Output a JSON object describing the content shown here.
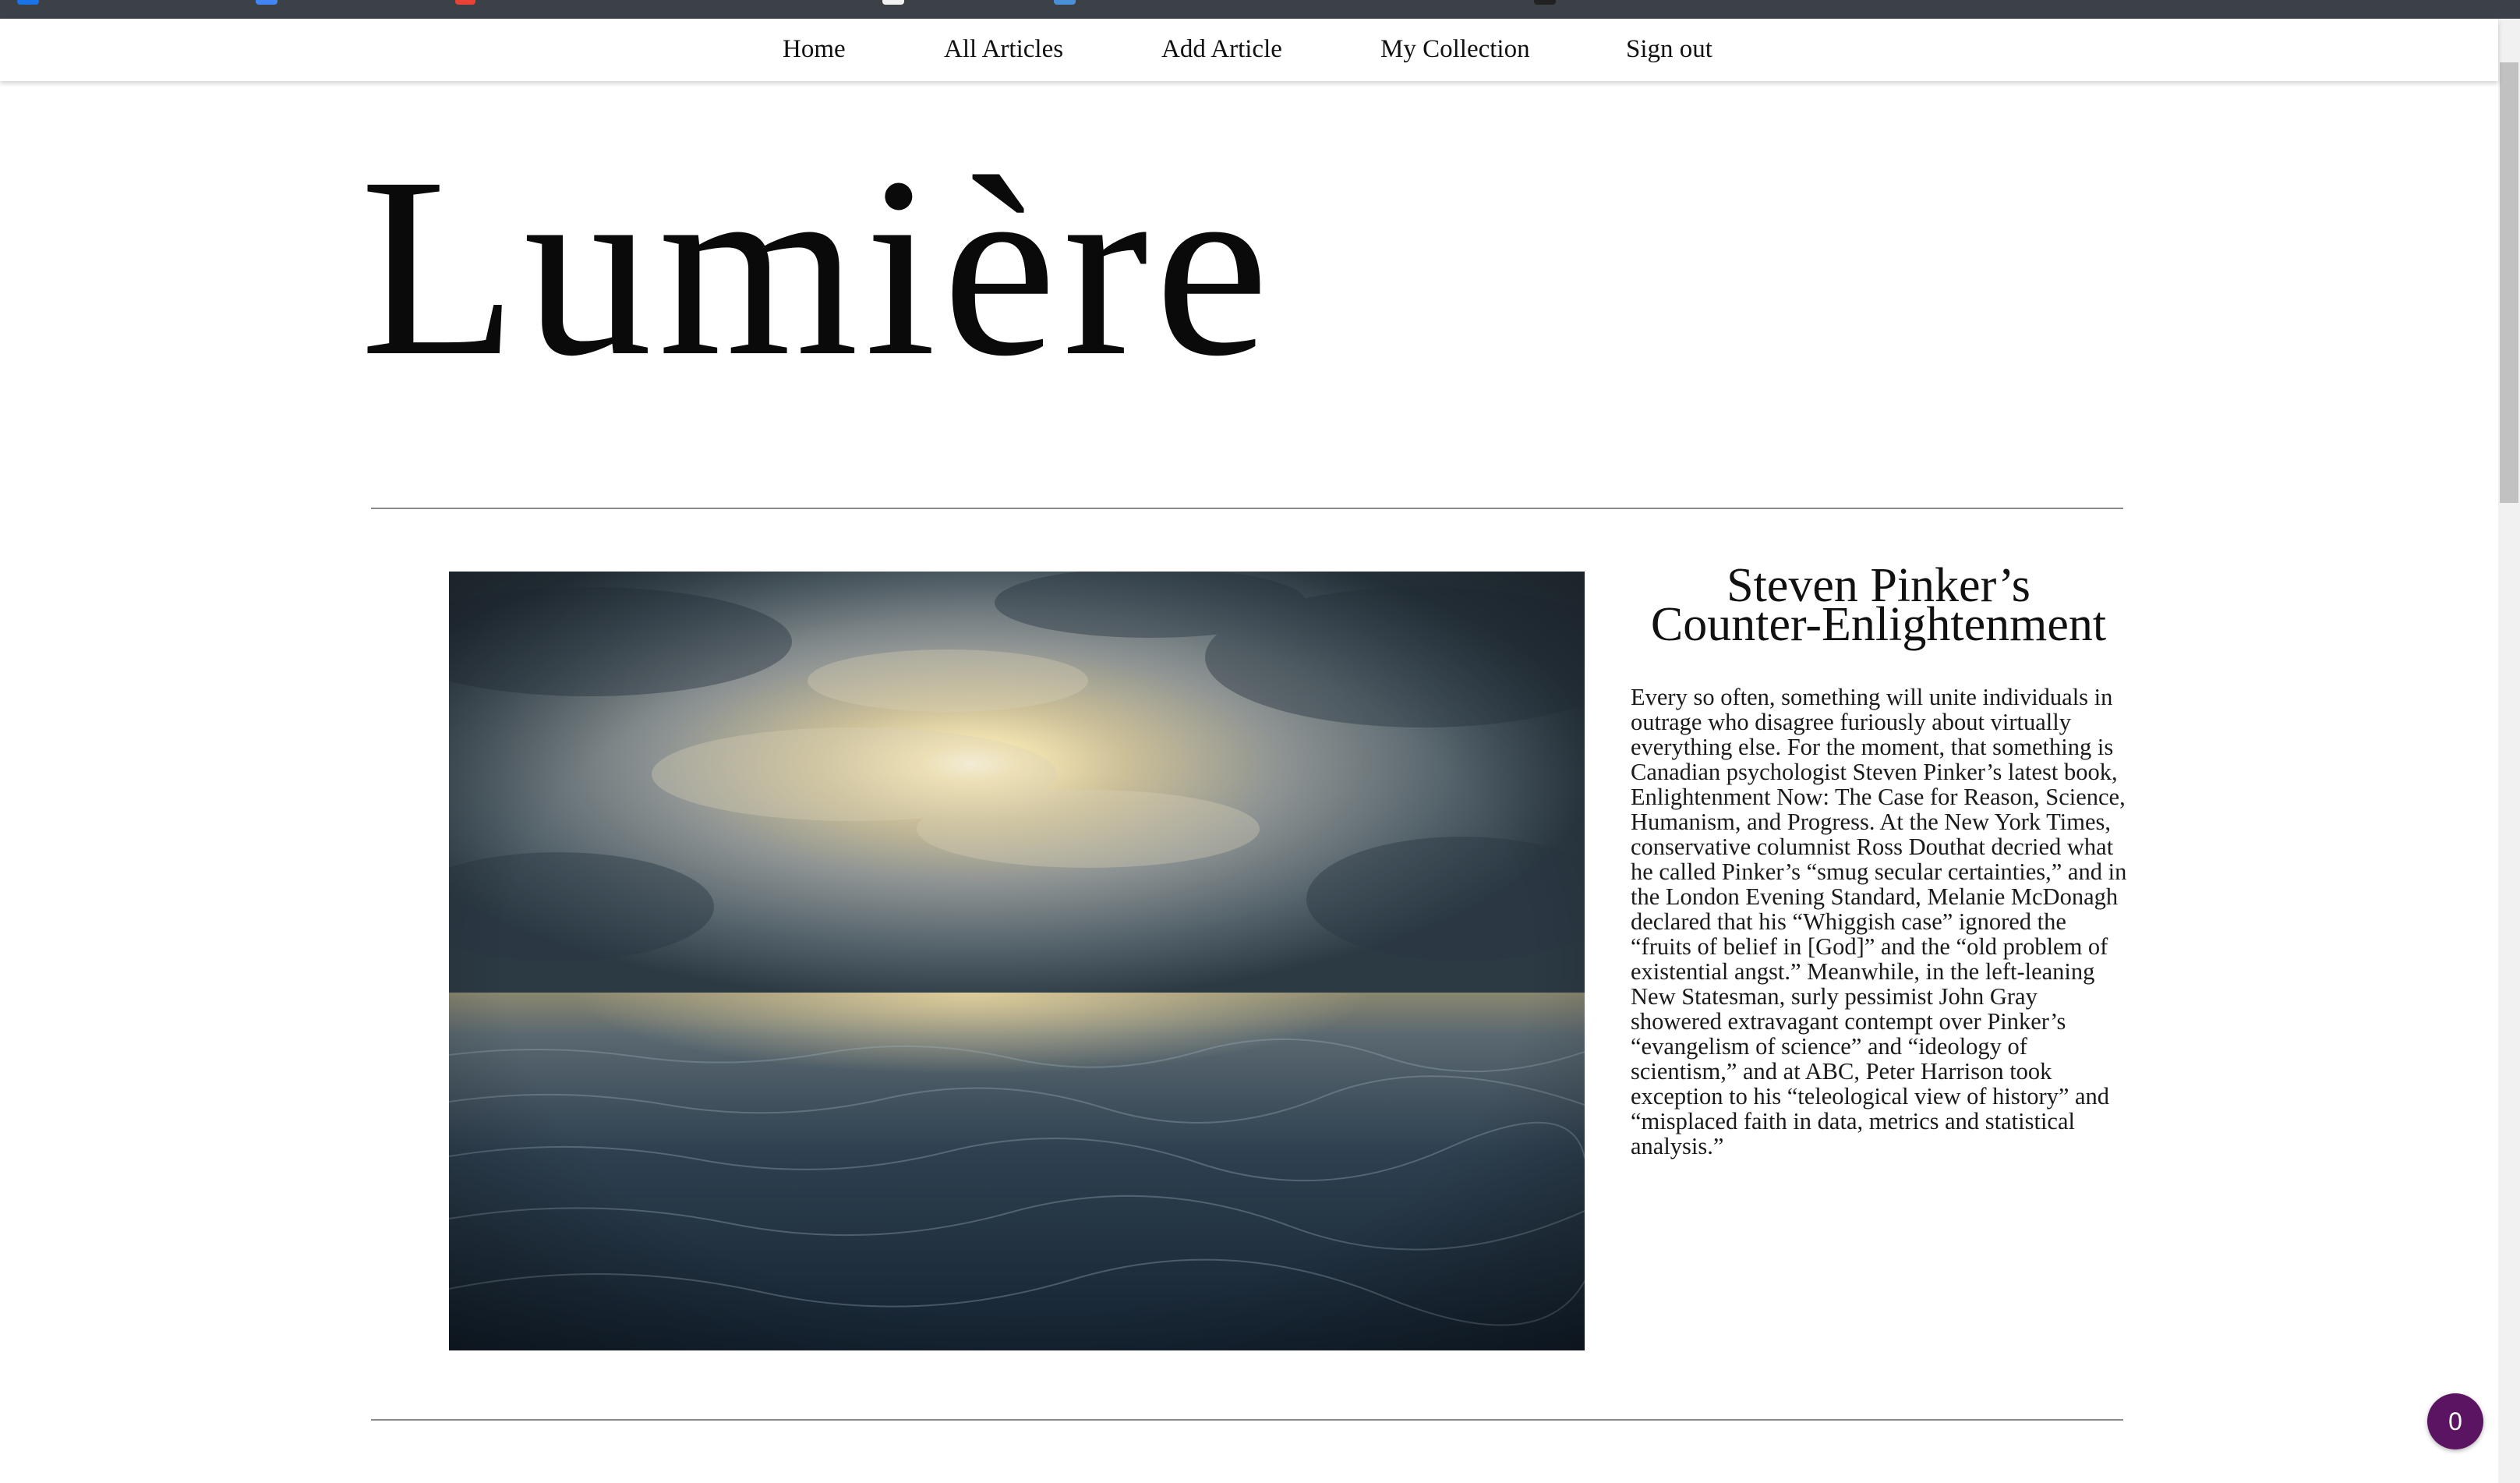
{
  "nav": {
    "items": [
      {
        "label": "Home"
      },
      {
        "label": "All Articles"
      },
      {
        "label": "Add Article"
      },
      {
        "label": "My Collection"
      },
      {
        "label": "Sign out"
      }
    ]
  },
  "site": {
    "logo": "Lumière"
  },
  "article": {
    "title_line1": "Steven Pinker’s",
    "title_line2": "Counter-Enlightenment",
    "excerpt": "Every so often, something will unite individuals in outrage who disagree furiously about virtually everything else. For the moment, that something is Canadian psychologist Steven Pinker’s latest book, Enlightenment Now: The Case for Reason, Science, Humanism, and Progress. At the New York Times, conservative columnist Ross Douthat decried what he called Pinker’s “smug secular certainties,” and in the London Evening Standard, Melanie McDonagh declared that his “Whiggish case” ignored the “fruits of belief in [God]” and the “old problem of existential angst.” Meanwhile, in the left-leaning New Statesman, surly pessimist John Gray showered extravagant contempt over Pinker’s “evangelism of science” and “ideology of scientism,” and at ABC, Peter Harrison took exception to his “teleological view of history” and “misplaced faith in data, metrics and statistical analysis.”",
    "image_icon": "stormy-sea-sunset-image"
  },
  "collection_badge": {
    "count": "0"
  },
  "colors": {
    "browser_bar": "#3c4148",
    "badge": "#5b1462",
    "rule": "#8a8a8a"
  }
}
